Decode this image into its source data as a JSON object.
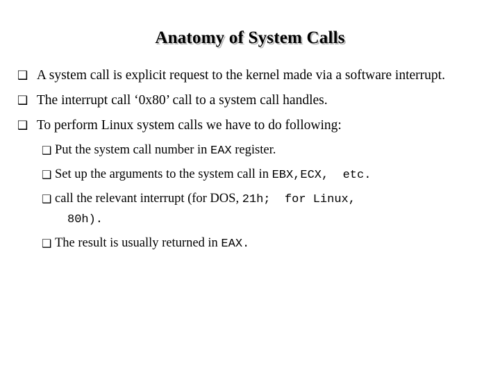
{
  "slide": {
    "title": "Anatomy of System Calls",
    "background_color": "#ffffff",
    "text_color": "#000000",
    "title_shadow_color": "#b9b9b9",
    "bullet_glyph": "❑",
    "bullets": [
      {
        "level": 1,
        "marker": "❑",
        "text": " A system call is explicit request to the kernel made via a software interrupt."
      },
      {
        "level": 1,
        "marker": "❑",
        "text": " The interrupt call ‘0x80’ call to a system call handles."
      },
      {
        "level": 1,
        "marker": "❑",
        "text": " To perform Linux system calls we have to do following:"
      },
      {
        "level": 2,
        "marker": "❑",
        "part_1": "Put the system call number in ",
        "code_1": "EAX",
        "part_2": " register."
      },
      {
        "level": 2,
        "marker": "❑",
        "part_1": "Set up the arguments to the system call in ",
        "code_1": "EBX,ECX,  etc.",
        "part_2": ""
      },
      {
        "level": 2,
        "marker": "❑",
        "part_1": "call the relevant interrupt (for DOS, ",
        "code_1": "21h;  for Linux,",
        "part_2": "",
        "continuation_code": "80h)."
      },
      {
        "level": 2,
        "marker": "❑",
        "part_1": "The result is usually returned in ",
        "code_1": "EAX.",
        "part_2": ""
      }
    ]
  }
}
